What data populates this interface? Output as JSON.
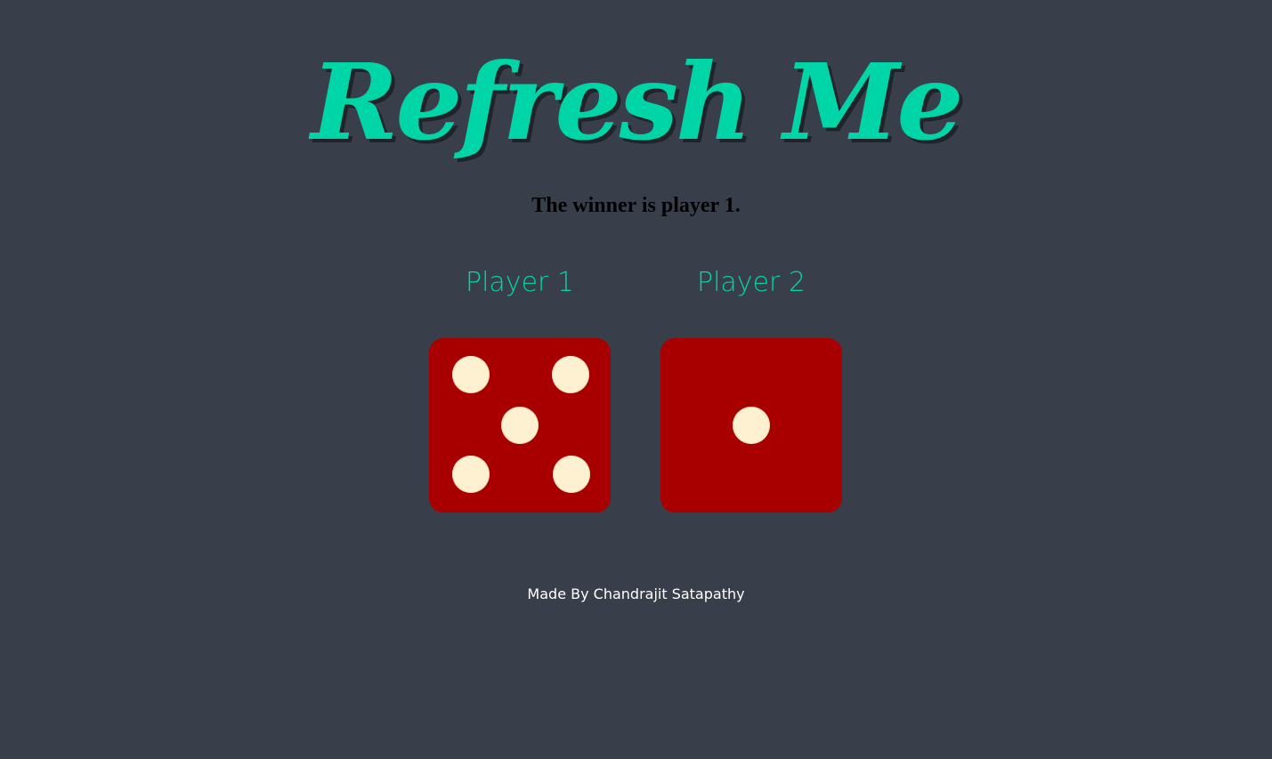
{
  "header": {
    "title": "Refresh Me"
  },
  "result": {
    "text": "The winner is player 1."
  },
  "players": [
    {
      "label": "Player 1",
      "die_value": 5
    },
    {
      "label": "Player 2",
      "die_value": 1
    }
  ],
  "footer": {
    "text": "Made By Chandrajit Satapathy"
  },
  "colors": {
    "background": "#393f4a",
    "accent": "#00d5a8",
    "die": "#a80000",
    "pip": "#fdf1d2"
  }
}
